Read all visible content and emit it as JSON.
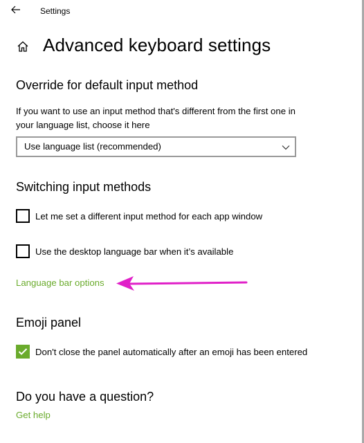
{
  "window": {
    "title": "Settings"
  },
  "page": {
    "title": "Advanced keyboard settings"
  },
  "override_section": {
    "title": "Override for default input method",
    "description": "If you want to use an input method that's different from the first one in your language list, choose it here",
    "dropdown_value": "Use language list (recommended)"
  },
  "switching_section": {
    "title": "Switching input methods",
    "options": [
      {
        "label": "Let me set a different input method for each app window",
        "checked": false
      },
      {
        "label": "Use the desktop language bar when it’s available",
        "checked": false
      }
    ],
    "link": "Language bar options"
  },
  "emoji_section": {
    "title": "Emoji panel",
    "option": {
      "label": "Don't close the panel automatically after an emoji has been entered",
      "checked": true
    }
  },
  "question_section": {
    "title": "Do you have a question?",
    "link": "Get help"
  },
  "colors": {
    "accent": "#6aab2c",
    "annotation_arrow": "#e020c8"
  },
  "icons": {
    "back": "back-arrow-icon",
    "home": "home-icon",
    "dropdown": "chevron-down-icon",
    "checkmark": "checkmark-icon"
  }
}
